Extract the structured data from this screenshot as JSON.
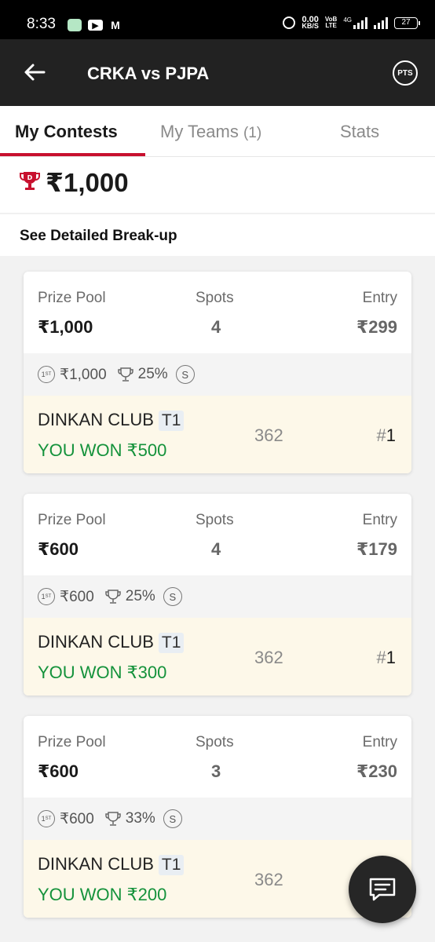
{
  "status_bar": {
    "time": "8:33",
    "net_speed_value": "0.00",
    "net_speed_unit": "KB/S",
    "volte_top": "VoB",
    "volte_bottom": "LTE",
    "network_type": "4G",
    "battery": "27"
  },
  "header": {
    "title": "CRKA vs PJPA",
    "points_button": "PTS"
  },
  "tabs": [
    {
      "label": "My Contests",
      "active": true
    },
    {
      "label": "My Teams",
      "count": "(1)",
      "active": false
    },
    {
      "label": "Stats",
      "active": false
    }
  ],
  "summary": {
    "total_winnings": "₹1,000"
  },
  "breakup_link": "See Detailed Break-up",
  "labels": {
    "prize_pool": "Prize Pool",
    "spots": "Spots",
    "entry": "Entry"
  },
  "contests": [
    {
      "prize_pool": "₹1,000",
      "spots": "4",
      "entry": "₹299",
      "first_prize": "₹1,000",
      "winners_percent": "25%",
      "team_name": "DINKAN CLUB",
      "team_tag": "T1",
      "won_text": "YOU WON ₹500",
      "points": "362",
      "rank": "1"
    },
    {
      "prize_pool": "₹600",
      "spots": "4",
      "entry": "₹179",
      "first_prize": "₹600",
      "winners_percent": "25%",
      "team_name": "DINKAN CLUB",
      "team_tag": "T1",
      "won_text": "YOU WON ₹300",
      "points": "362",
      "rank": "1"
    },
    {
      "prize_pool": "₹600",
      "spots": "3",
      "entry": "₹230",
      "first_prize": "₹600",
      "winners_percent": "33%",
      "team_name": "DINKAN CLUB",
      "team_tag": "T1",
      "won_text": "YOU WON ₹200",
      "points": "362",
      "rank": ""
    }
  ],
  "icons": {
    "back": "arrow-left-icon",
    "trophy": "trophy-icon",
    "first_prize": "first-place-icon",
    "cup": "cup-icon",
    "single_entry": "single-entry-icon",
    "chat": "chat-icon"
  },
  "colors": {
    "accent": "#c8102e",
    "header_bg": "#222222",
    "win_green": "#14923b",
    "team_row_bg": "#fdf8e9"
  }
}
